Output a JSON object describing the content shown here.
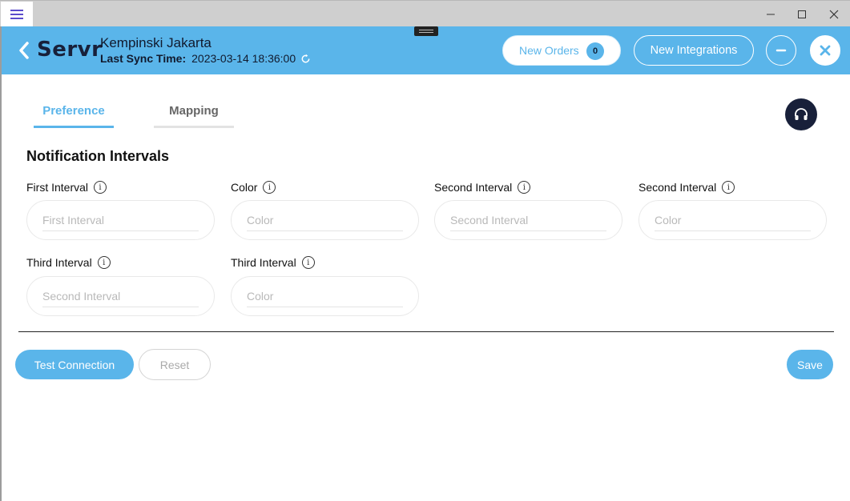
{
  "header": {
    "logo_text": "Servr",
    "hotel_name": "Kempinski Jakarta",
    "last_sync_label": "Last Sync Time:",
    "last_sync_value": "2023-03-14 18:36:00",
    "new_orders_label": "New Orders",
    "new_orders_count": "0",
    "new_integrations_label": "New Integrations",
    "accent_color": "#5ab5ea",
    "dark_color": "#18203a"
  },
  "tabs": [
    {
      "label": "Preference",
      "active": true
    },
    {
      "label": "Mapping",
      "active": false
    }
  ],
  "section": {
    "title": "Notification Intervals"
  },
  "fields": [
    {
      "label": "First Interval",
      "placeholder": "First Interval",
      "value": ""
    },
    {
      "label": "Color",
      "placeholder": "Color",
      "value": ""
    },
    {
      "label": "Second Interval",
      "placeholder": "Second Interval",
      "value": ""
    },
    {
      "label": "Second Interval",
      "placeholder": "Color",
      "value": ""
    },
    {
      "label": "Third Interval",
      "placeholder": "Second Interval",
      "value": ""
    },
    {
      "label": "Third Interval",
      "placeholder": "Color",
      "value": ""
    }
  ],
  "info_glyph": "i",
  "actions": {
    "test_connection": "Test Connection",
    "reset": "Reset",
    "save": "Save"
  },
  "icons": {
    "app_menu": "hamburger-icon",
    "back": "chevron-left-icon",
    "sync": "refresh-icon",
    "minimize_app": "minus-icon",
    "close_app": "close-icon",
    "support": "headset-icon",
    "info": "info-icon"
  }
}
